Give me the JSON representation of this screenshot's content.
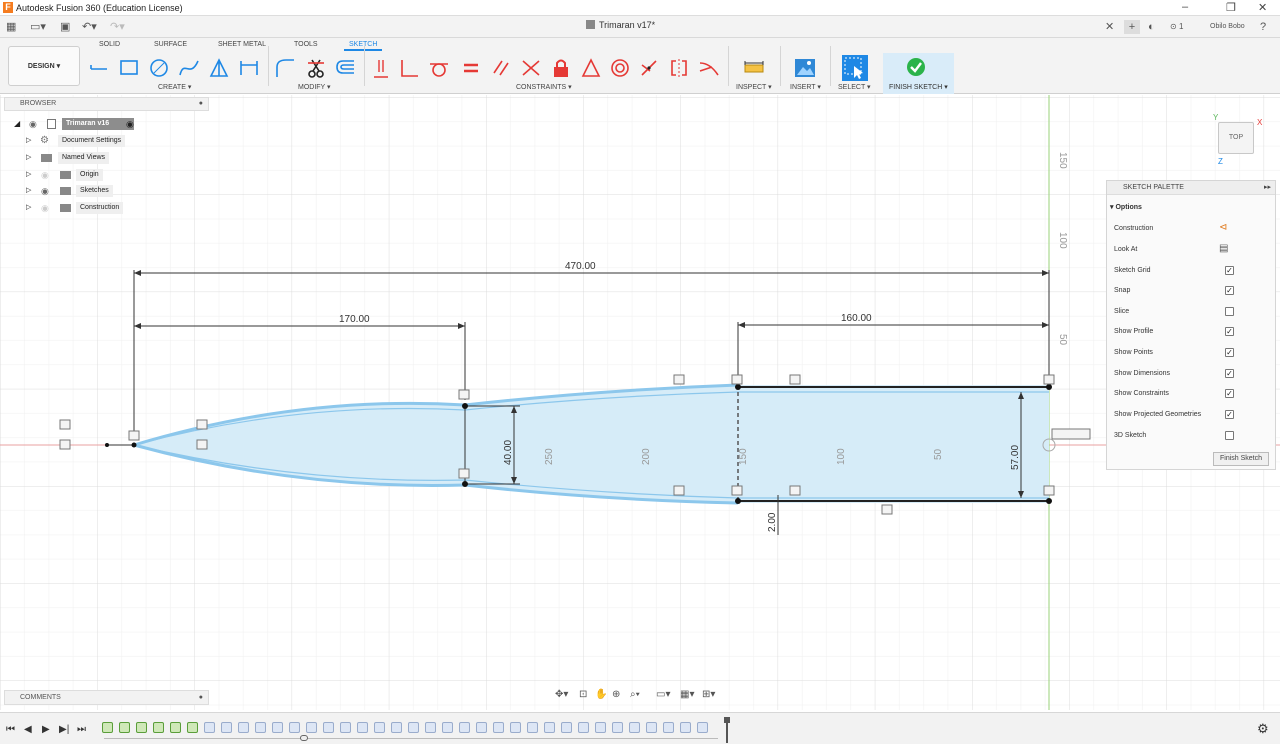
{
  "app": {
    "title": "Autodesk Fusion 360 (Education License)",
    "user": "Obilo Bobo",
    "notifications": "1"
  },
  "document": {
    "tab_name": "Trimaran v17*"
  },
  "workspace": {
    "label": "DESIGN"
  },
  "ribbon": {
    "tabs": [
      "SOLID",
      "SURFACE",
      "SHEET METAL",
      "TOOLS",
      "SKETCH"
    ],
    "active_tab": "SKETCH",
    "groups": {
      "create": "CREATE",
      "modify": "MODIFY",
      "constraints": "CONSTRAINTS",
      "inspect": "INSPECT",
      "insert": "INSERT",
      "select": "SELECT",
      "finish": "FINISH SKETCH"
    }
  },
  "browser": {
    "title": "BROWSER",
    "root": "Trimaran v16",
    "items": [
      "Document Settings",
      "Named Views",
      "Origin",
      "Sketches",
      "Construction"
    ]
  },
  "palette": {
    "title": "SKETCH PALETTE",
    "section": "Options",
    "options": [
      {
        "label": "Construction",
        "control": "icon"
      },
      {
        "label": "Look At",
        "control": "icon"
      },
      {
        "label": "Sketch Grid",
        "checked": true
      },
      {
        "label": "Snap",
        "checked": true
      },
      {
        "label": "Slice",
        "checked": false
      },
      {
        "label": "Show Profile",
        "checked": true
      },
      {
        "label": "Show Points",
        "checked": true
      },
      {
        "label": "Show Dimensions",
        "checked": true
      },
      {
        "label": "Show Constraints",
        "checked": true
      },
      {
        "label": "Show Projected Geometries",
        "checked": true
      },
      {
        "label": "3D Sketch",
        "checked": false
      }
    ],
    "finish_button": "Finish Sketch"
  },
  "sketch": {
    "dimensions": {
      "overall": "470.00",
      "front": "170.00",
      "rear": "160.00",
      "mid_height": "40.00",
      "rear_height": "57.00",
      "offset": "2.00"
    },
    "ruler_horizontal": [
      "250",
      "200",
      "150",
      "100",
      "50"
    ],
    "ruler_vertical": [
      "150",
      "100",
      "50"
    ]
  },
  "viewcube": {
    "face": "TOP",
    "axis_x": "X",
    "axis_y": "Y",
    "axis_z": "Z"
  },
  "comments": {
    "title": "COMMENTS"
  },
  "colors": {
    "accent": "#1e88e5",
    "profile_fill": "#d6ecf8",
    "sketch_line": "#8cc7ec",
    "axis_red": "#e8a0a0",
    "axis_green": "#9ad27a",
    "finish_green": "#2bb34a"
  }
}
